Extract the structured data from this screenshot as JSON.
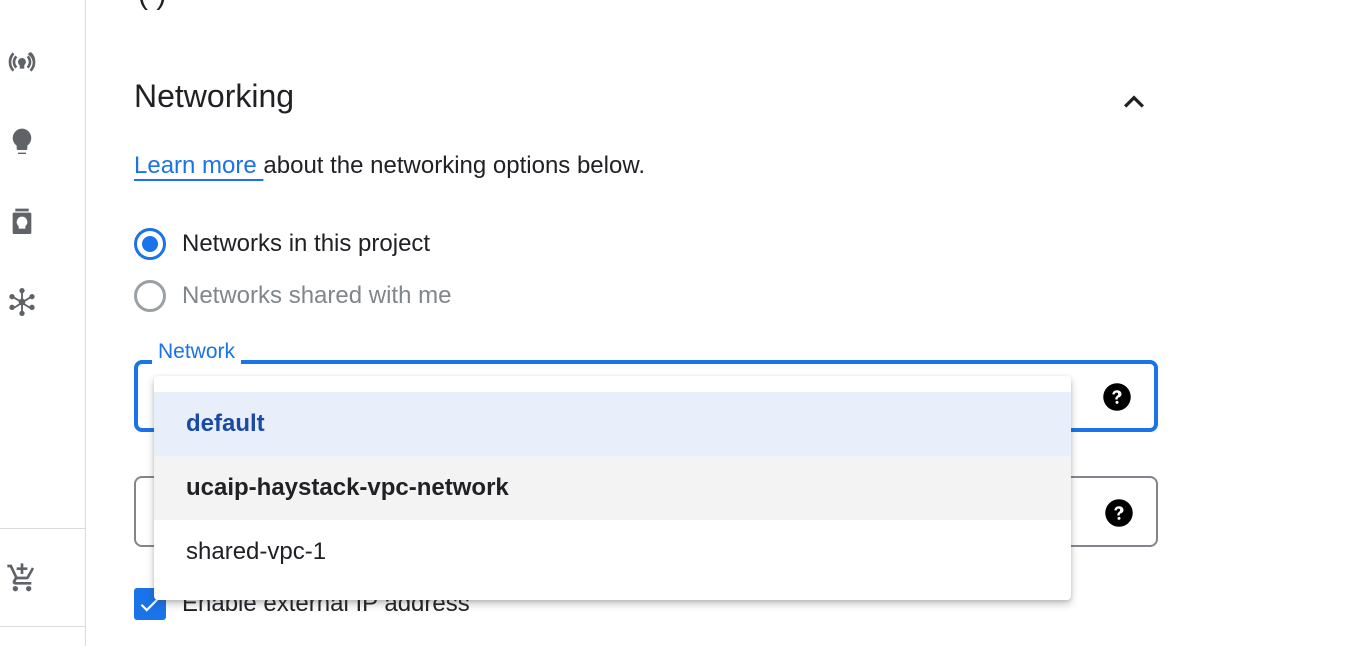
{
  "top_cutoff_text": "(   )",
  "sidebar": {
    "icons": [
      "broadcast-icon",
      "lightbulb-icon",
      "badge-bulb-icon",
      "network-hub-icon",
      "cart-add-icon"
    ]
  },
  "section": {
    "title": "Networking",
    "learn_more_link": "Learn more ",
    "learn_more_rest": "about the networking options below."
  },
  "radios": [
    {
      "label": "Networks in this project",
      "checked": true
    },
    {
      "label": "Networks shared with me",
      "checked": false
    }
  ],
  "network_field": {
    "label": "Network",
    "selected_value": "default"
  },
  "dropdown": {
    "options": [
      "default",
      "ucaip-haystack-vpc-network",
      "shared-vpc-1"
    ],
    "selected_index": 0,
    "hover_index": 1
  },
  "checkbox": {
    "label": "Enable external IP address",
    "checked": true
  },
  "colors": {
    "accent": "#1a73e8",
    "selected_bg": "#e8eefa",
    "hover_bg": "#f3f3f3",
    "icon_gray": "#5f6368"
  }
}
